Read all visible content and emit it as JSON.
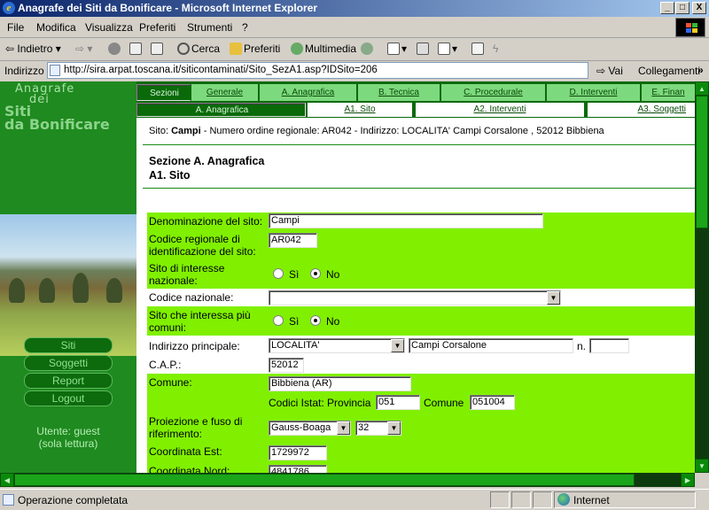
{
  "window": {
    "title": "Anagrafe dei Siti da Bonificare - Microsoft Internet Explorer",
    "btn_min": "_",
    "btn_max": "□",
    "btn_close": "X"
  },
  "menu": {
    "items": [
      "File",
      "Modifica",
      "Visualizza",
      "Preferiti",
      "Strumenti",
      "?"
    ]
  },
  "toolbar": {
    "back": "Indietro",
    "search": "Cerca",
    "favorites": "Preferiti",
    "multimedia": "Multimedia"
  },
  "address": {
    "label": "Indirizzo",
    "url": "http://sira.arpat.toscana.it/siticontaminati/Sito_SezA1.asp?IDSito=206",
    "go": "Vai",
    "links": "Collegamenti",
    "links_more": "»"
  },
  "sidebar": {
    "logo_line1": "Anagrafe",
    "logo_line2": "dei",
    "logo_line3": "Siti",
    "logo_line4": "da Bonificare",
    "buttons": [
      "Siti",
      "Soggetti",
      "Report",
      "Logout"
    ],
    "user_line1": "Utente: guest",
    "user_line2": "(sola lettura)"
  },
  "tabs_main": [
    "Sezioni",
    "Generale",
    "A. Anagrafica",
    "B. Tecnica",
    "C. Procedurale",
    "D. Interventi",
    "E. Finan"
  ],
  "tabs_sub": [
    "A. Anagrafica",
    "A1. Sito",
    "A2. Interventi",
    "A3. Soggetti"
  ],
  "site": {
    "prefix": "Sito:",
    "name": "Campi",
    "rest": "- Numero ordine regionale: AR042 - Indirizzo: LOCALITA' Campi Corsalone , 52012 Bibbiena"
  },
  "section": {
    "title": "Sezione A. Anagrafica",
    "subtitle": "A1. Sito"
  },
  "form": {
    "denominazione_label": "Denominazione del sito:",
    "denominazione_value": "Campi",
    "codice_reg_label": "Codice regionale di identificazione del sito:",
    "codice_reg_value": "AR042",
    "interesse_naz_label": "Sito di interesse nazionale:",
    "radio_si": "Sì",
    "radio_no": "No",
    "codice_naz_label": "Codice nazionale:",
    "codice_naz_value": "",
    "piu_comuni_label": "Sito che interessa più comuni:",
    "indirizzo_label": "Indirizzo principale:",
    "indirizzo_tipo": "LOCALITA'",
    "indirizzo_via": "Campi Corsalone",
    "n_label": "n.",
    "n_value": "",
    "cap_label": "C.A.P.:",
    "cap_value": "52012",
    "comune_label": "Comune:",
    "comune_value": "Bibbiena (AR)",
    "istat_prov_label": "Codici Istat: Provincia",
    "istat_prov_value": "051",
    "istat_com_label": "Comune",
    "istat_com_value": "051004",
    "proiezione_label": "Proiezione e fuso di riferimento:",
    "proiezione_value": "Gauss-Boaga",
    "fuso_value": "32",
    "coord_est_label": "Coordinata Est:",
    "coord_est_value": "1729972",
    "coord_nord_label": "Coordinata Nord:",
    "coord_nord_value": "4841786"
  },
  "status": {
    "text": "Operazione completata",
    "zone": "Internet"
  }
}
